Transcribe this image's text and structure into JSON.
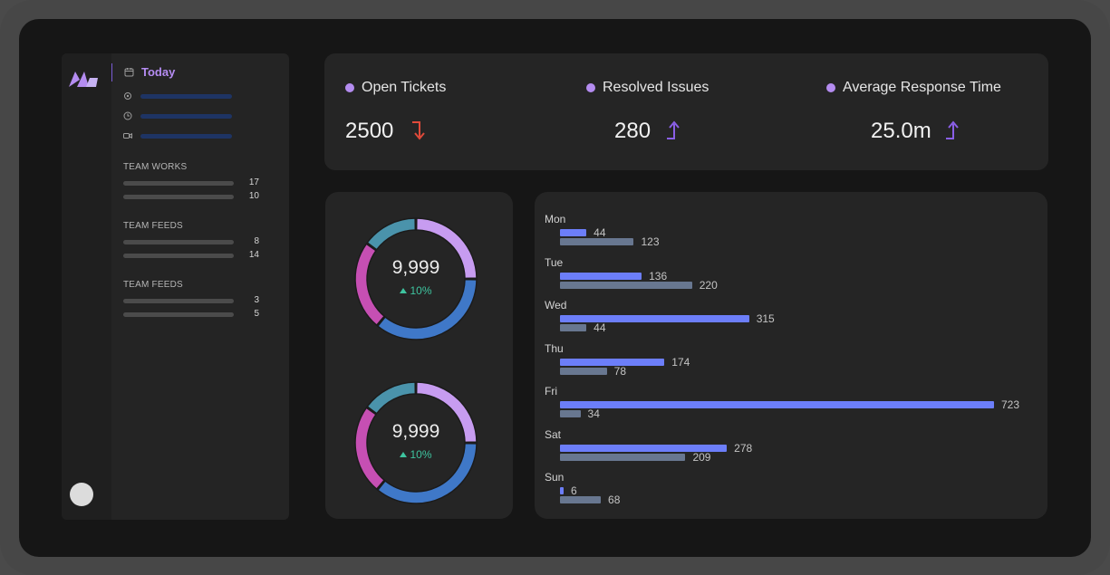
{
  "sidebar": {
    "today_label": "Today",
    "sections": [
      {
        "title": "TEAM WORKS",
        "values": [
          "17",
          "10"
        ]
      },
      {
        "title": "TEAM FEEDS",
        "values": [
          "8",
          "14"
        ]
      },
      {
        "title": "TEAM FEEDS",
        "values": [
          "3",
          "5"
        ]
      }
    ]
  },
  "kpis": [
    {
      "label": "Open Tickets",
      "value": "2500",
      "trend": "down",
      "color": "#e04a3a"
    },
    {
      "label": "Resolved Issues",
      "value": "280",
      "trend": "up",
      "color": "#8a5fe6"
    },
    {
      "label": "Average Response Time",
      "value": "25.0m",
      "trend": "up",
      "color": "#8a5fe6"
    }
  ],
  "donuts": [
    {
      "value": "9,999",
      "change": "10%"
    },
    {
      "value": "9,999",
      "change": "10%"
    }
  ],
  "donut_segments": [
    {
      "name": "lavender",
      "color": "#c79cf0",
      "fraction": 0.25
    },
    {
      "name": "blue",
      "color": "#3f78c8",
      "fraction": 0.36
    },
    {
      "name": "magenta",
      "color": "#c64fb3",
      "fraction": 0.24
    },
    {
      "name": "teal",
      "color": "#4a93ab",
      "fraction": 0.15
    }
  ],
  "chart_data": {
    "type": "bar",
    "orientation": "horizontal",
    "categories": [
      "Mon",
      "Tue",
      "Wed",
      "Thu",
      "Fri",
      "Sat",
      "Sun"
    ],
    "series": [
      {
        "color": "#6c7ef9",
        "values": [
          44,
          136,
          315,
          174,
          723,
          278,
          6
        ]
      },
      {
        "color": "#687790",
        "values": [
          123,
          220,
          44,
          78,
          34,
          209,
          68
        ]
      }
    ],
    "xlim": [
      0,
      723
    ]
  },
  "colors": {
    "accent": "#b48cf0",
    "up": "#8a5fe6",
    "down": "#e04a3a",
    "positive": "#3ec49f"
  }
}
